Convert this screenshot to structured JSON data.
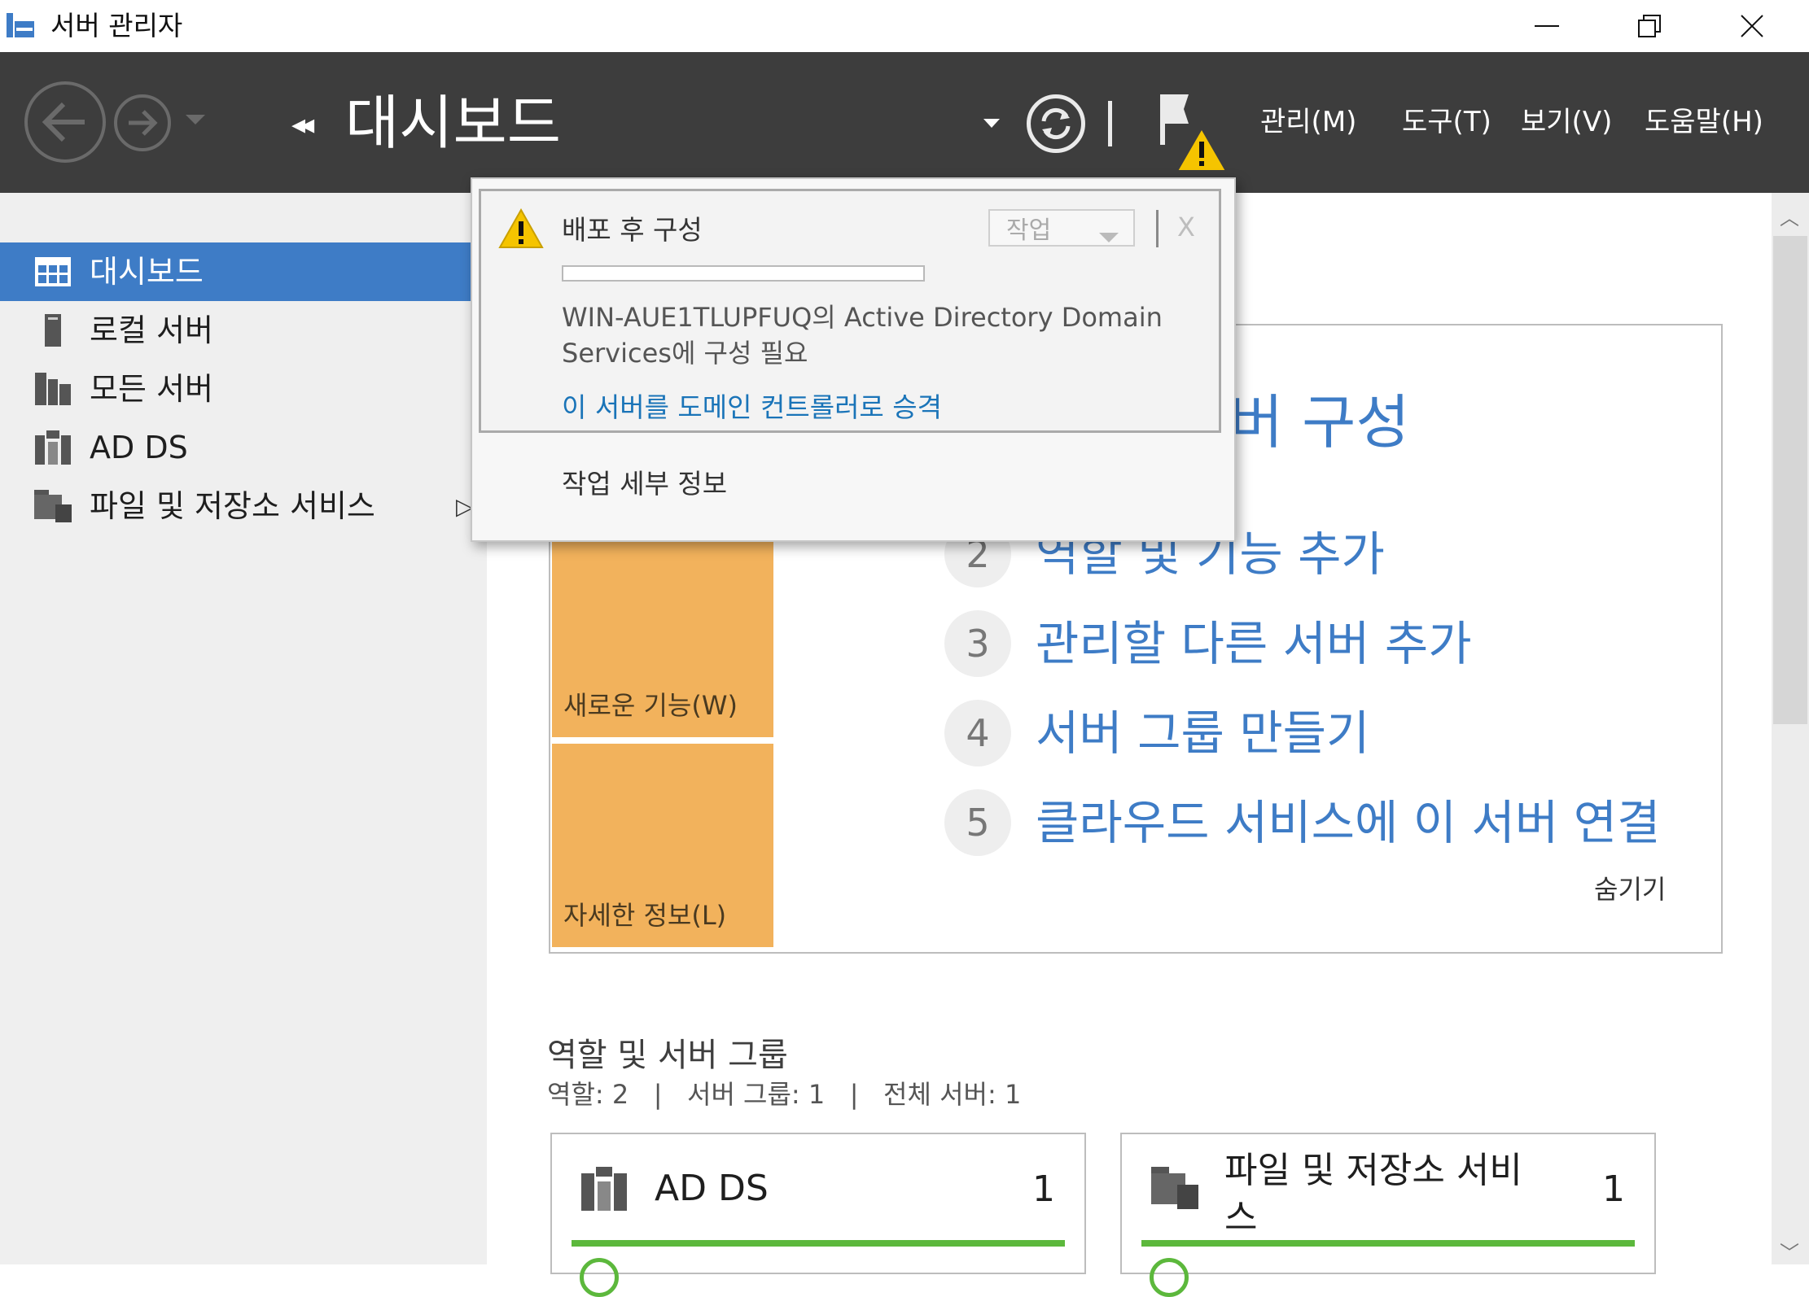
{
  "window": {
    "title": "서버 관리자"
  },
  "header": {
    "page_title": "대시보드",
    "menu": [
      "관리(M)",
      "도구(T)",
      "보기(V)",
      "도움말(H)"
    ]
  },
  "sidebar": {
    "items": [
      {
        "label": "대시보드",
        "icon": "dashboard-icon",
        "selected": true
      },
      {
        "label": "로컬 서버",
        "icon": "server-icon"
      },
      {
        "label": "모든 서버",
        "icon": "servers-icon"
      },
      {
        "label": "AD DS",
        "icon": "ad-ds-icon"
      },
      {
        "label": "파일 및 저장소 서비스",
        "icon": "file-storage-icon"
      }
    ]
  },
  "quickstart": {
    "title_partial": "버 구성",
    "tiles": {
      "new": "새로운 기능(W)",
      "more": "자세한 정보(L)"
    },
    "steps": [
      {
        "num": "2",
        "label": "역할 및 기능 추가"
      },
      {
        "num": "3",
        "label": "관리할 다른 서버 추가"
      },
      {
        "num": "4",
        "label": "서버 그룹 만들기"
      },
      {
        "num": "5",
        "label": "클라우드 서비스에 이 서버 연결"
      }
    ],
    "hide": "숨기기"
  },
  "roles": {
    "title": "역할 및 서버 그룹",
    "summary": "역할: 2   |   서버 그룹: 1   |   전체 서버: 1",
    "cards": [
      {
        "name": "AD DS",
        "count": "1"
      },
      {
        "name": "파일 및 저장소 서비\n스",
        "count": "1"
      }
    ]
  },
  "notification": {
    "title": "배포 후 구성",
    "task_button": "작업",
    "close": "X",
    "message": "WIN-AUE1TLUPFUQ의 Active Directory Domain Services에 구성 필요",
    "link": "이 서버를 도메인 컨트롤러로 승격",
    "details": "작업 세부 정보"
  },
  "colors": {
    "accent": "#3e7cc6",
    "header_bg": "#3d3d3d",
    "tile": "#f2b25c",
    "status_ok": "#5cb83c"
  }
}
